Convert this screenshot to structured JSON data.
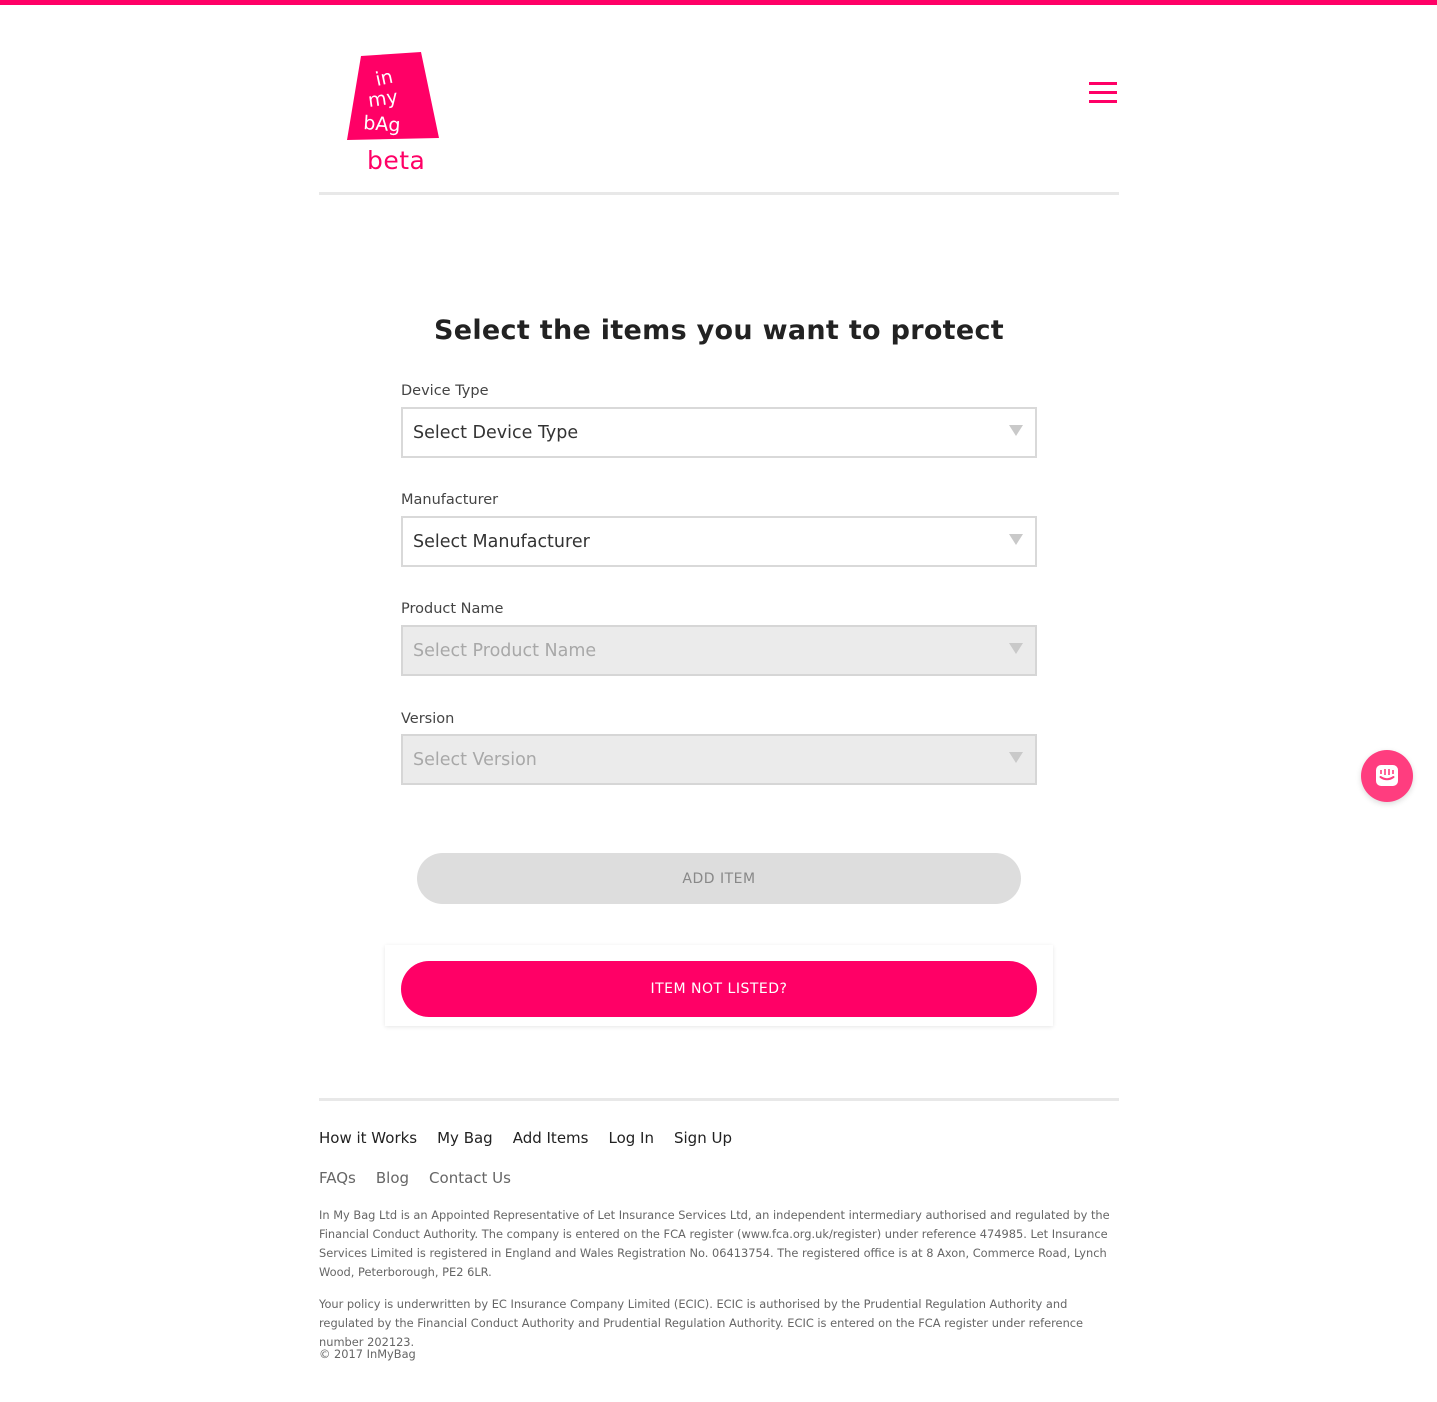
{
  "brand": {
    "logo_text": "in my bAg",
    "beta_label": "beta",
    "accent_color": "#ff0066"
  },
  "header": {
    "menu_icon": "hamburger-menu-icon"
  },
  "main": {
    "title": "Select the items you want to protect",
    "fields": [
      {
        "label": "Device Type",
        "placeholder": "Select Device Type",
        "disabled": false
      },
      {
        "label": "Manufacturer",
        "placeholder": "Select Manufacturer",
        "disabled": false
      },
      {
        "label": "Product Name",
        "placeholder": "Select Product Name",
        "disabled": true
      },
      {
        "label": "Version",
        "placeholder": "Select Version",
        "disabled": true
      }
    ],
    "add_item_label": "ADD ITEM",
    "not_listed_label": "ITEM NOT LISTED?"
  },
  "footer": {
    "primary_links": [
      "How it Works",
      "My Bag",
      "Add Items",
      "Log In",
      "Sign Up"
    ],
    "secondary_links": [
      "FAQs",
      "Blog",
      "Contact Us"
    ],
    "legal_1": "In My Bag Ltd is an Appointed Representative of Let Insurance Services Ltd, an independent intermediary authorised and regulated by the Financial Conduct Authority. The company is entered on the FCA register (www.fca.org.uk/register) under reference 474985. Let Insurance Services Limited is registered in England and Wales Registration No. 06413754. The registered office is at 8 Axon, Commerce Road, Lynch Wood, Peterborough, PE2 6LR.",
    "legal_2": "Your policy is underwritten by EC Insurance Company Limited (ECIC). ECIC is authorised by the Prudential Regulation Authority and regulated by the Financial Conduct Authority and Prudential Regulation Authority. ECIC is entered on the FCA register under reference number 202123.",
    "copyright": "© 2017 InMyBag"
  },
  "chat": {
    "icon": "chat-icon"
  }
}
